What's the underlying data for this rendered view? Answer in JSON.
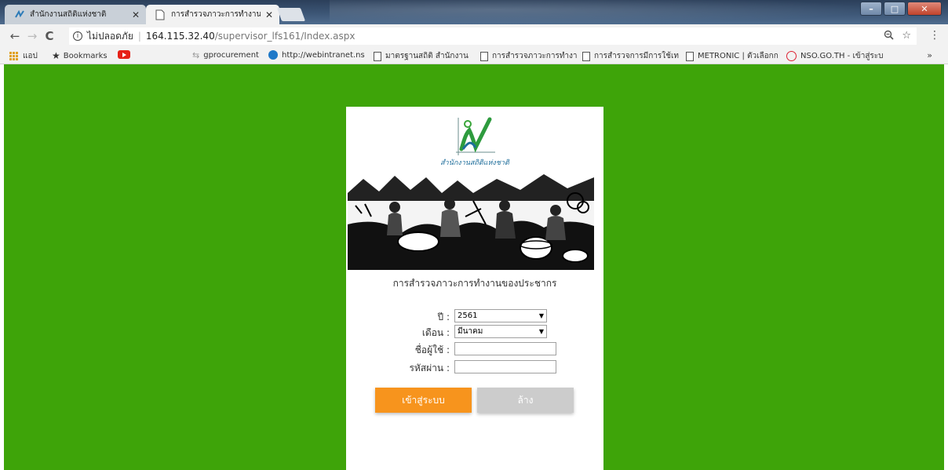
{
  "browser": {
    "tabs": [
      {
        "title": "สำนักงานสถิติแห่งชาติ",
        "active": false
      },
      {
        "title": "การสำรวจภาวะการทำงานขอ",
        "active": true
      }
    ],
    "window_controls": {
      "minimize": "–",
      "maximize": "□",
      "close": "✕"
    },
    "nav": {
      "back": "←",
      "forward": "→",
      "reload": "C"
    },
    "address": {
      "security_label": "ไม่ปลอดภัย",
      "host": "164.115.32.40",
      "path": "/supervisor_lfs161/Index.aspx"
    },
    "bookmarks": [
      {
        "label": "แอป",
        "icon": "apps-icon"
      },
      {
        "label": "Bookmarks",
        "icon": "star-icon"
      },
      {
        "label": "",
        "icon": "youtube-icon"
      },
      {
        "label": "gprocurement",
        "icon": "gprocurement-icon"
      },
      {
        "label": "http://webintranet.ns",
        "icon": "edge-icon"
      },
      {
        "label": "มาตรฐานสถิติ สำนักงาน",
        "icon": "page-icon"
      },
      {
        "label": "การสำรวจภาวะการทำงา",
        "icon": "page-icon"
      },
      {
        "label": "การสำรวจการมีการใช้เท",
        "icon": "page-icon"
      },
      {
        "label": "METRONIC | ตัวเลือกก",
        "icon": "page-icon"
      },
      {
        "label": "NSO.GO.TH - เข้าสู่ระบ",
        "icon": "mail-icon"
      }
    ],
    "overflow": "»"
  },
  "login": {
    "org_name": "สำนักงานสถิติแห่งชาติ",
    "survey_title": "การสำรวจภาวะการทำงานของประชากร",
    "year_label": "ปี :",
    "year_value": "2561",
    "month_label": "เดือน :",
    "month_value": "มีนาคม",
    "username_label": "ชื่อผู้ใช้ :",
    "password_label": "รหัสผ่าน :",
    "login_button": "เข้าสู่ระบบ",
    "clear_button": "ล้าง"
  },
  "colors": {
    "background_green": "#3ea409",
    "login_button": "#f7941d",
    "clear_button": "#cccccc"
  }
}
